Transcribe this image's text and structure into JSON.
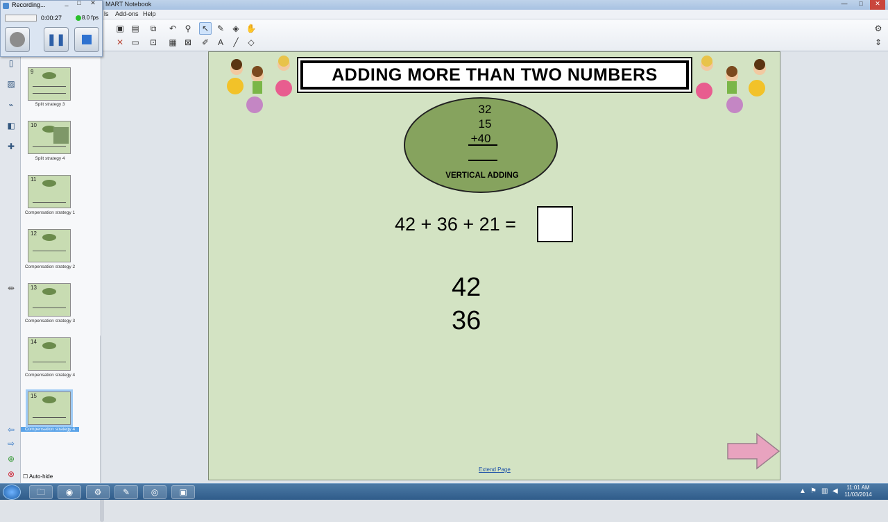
{
  "window": {
    "title": "MART Notebook",
    "minimize": "—",
    "maximize": "□",
    "close": "✕"
  },
  "menu": {
    "items": [
      "ls",
      "Add-ons",
      "Help"
    ]
  },
  "recorder": {
    "title": "Recording...",
    "timer": "0:00:27",
    "fps": "8.0 fps"
  },
  "sorter": {
    "thumbnails": [
      {
        "num": "9",
        "label": "Split strategy 3"
      },
      {
        "num": "10",
        "label": "Split strategy 4"
      },
      {
        "num": "11",
        "label": "Compensation strategy 1"
      },
      {
        "num": "12",
        "label": "Compensation strategy 2"
      },
      {
        "num": "13",
        "label": "Compensation strategy 3"
      },
      {
        "num": "14",
        "label": "Compensation strategy 4"
      },
      {
        "num": "15",
        "label": "Compensation strategy 4"
      }
    ],
    "autohide_label": "Auto-hide"
  },
  "slide": {
    "title": "ADDING MORE THAN TWO NUMBERS",
    "oval_numbers": [
      "32",
      "15",
      "+40"
    ],
    "oval_label": "VERTICAL ADDING",
    "equation": "42 + 36 + 21 =",
    "column_numbers": [
      "42",
      "36"
    ],
    "extend_page": "Extend Page"
  },
  "taskbar": {
    "time": "11:01 AM",
    "date": "11/03/2014"
  },
  "colors": {
    "slide_bg": "#d3e3c3",
    "oval_fill": "#86a35e",
    "arrow_fill": "#e8a3bf"
  }
}
